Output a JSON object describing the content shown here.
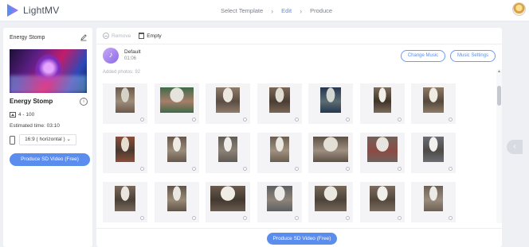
{
  "app": {
    "name": "LightMV"
  },
  "steps": [
    "Select Template",
    "Edit",
    "Produce"
  ],
  "active_step": 1,
  "left_panel": {
    "title": "Energy Stomp",
    "theme_name": "Energy Stomp",
    "photo_range": "4 - 100",
    "estimated_time": "Estimated time: 03:10",
    "ratio": "16:9 ( horizontal )",
    "produce_button": "Produce SD Video (Free)"
  },
  "toolbar": {
    "remove": "Remove",
    "empty": "Empty"
  },
  "music": {
    "name": "Default",
    "duration": "01:06",
    "change_button": "Change Music",
    "settings_button": "Music Settings"
  },
  "added_photos_label": "Added photos: 92",
  "produce_bottom_button": "Produce SD Video (Free)",
  "photos": [
    {
      "colors": [
        "#6b5a4c",
        "#d7d2c8",
        "#9c8c78"
      ]
    },
    {
      "colors": [
        "#3f6a48",
        "#e6e3dc",
        "#a77e6a"
      ]
    },
    {
      "colors": [
        "#8f7d6c",
        "#ece8e0",
        "#5b4d42"
      ]
    },
    {
      "colors": [
        "#7b6657",
        "#e2ddd3",
        "#4a3d33"
      ]
    },
    {
      "colors": [
        "#25364f",
        "#d4d6d3",
        "#5b6d72"
      ]
    },
    {
      "colors": [
        "#7a6b5c",
        "#f2efe8",
        "#3e3428"
      ]
    },
    {
      "colors": [
        "#8e7a66",
        "#f0ece4",
        "#55493c"
      ]
    },
    {
      "colors": [
        "#8a4e3a",
        "#e6ded0",
        "#4a3a30"
      ]
    },
    {
      "colors": [
        "#65574a",
        "#eeebe4",
        "#9b8c7c"
      ]
    },
    {
      "colors": [
        "#5f5a55",
        "#efedea",
        "#8c8276"
      ]
    },
    {
      "colors": [
        "#6a5c50",
        "#ebe8e1",
        "#a0927f"
      ]
    },
    {
      "colors": [
        "#5c5146",
        "#e3dfd7",
        "#9e8f80"
      ]
    },
    {
      "colors": [
        "#6e625a",
        "#e8e4de",
        "#8d4a45"
      ]
    },
    {
      "colors": [
        "#6b6e74",
        "#f2f1ee",
        "#4d4a47"
      ]
    },
    {
      "colors": [
        "#78695b",
        "#e9e6df",
        "#4b4138"
      ]
    },
    {
      "colors": [
        "#5f5448",
        "#eae7e1",
        "#9a8a78"
      ]
    },
    {
      "colors": [
        "#6a5b4e",
        "#f0ede7",
        "#433930"
      ]
    },
    {
      "colors": [
        "#5d5f63",
        "#eeece8",
        "#8e8479"
      ]
    },
    {
      "colors": [
        "#766859",
        "#ebe8e2",
        "#4d433a"
      ]
    },
    {
      "colors": [
        "#7a6c5e",
        "#f1efea",
        "#54483d"
      ]
    },
    {
      "colors": [
        "#6c6055",
        "#ecebe7",
        "#9a8c7d"
      ]
    }
  ]
}
